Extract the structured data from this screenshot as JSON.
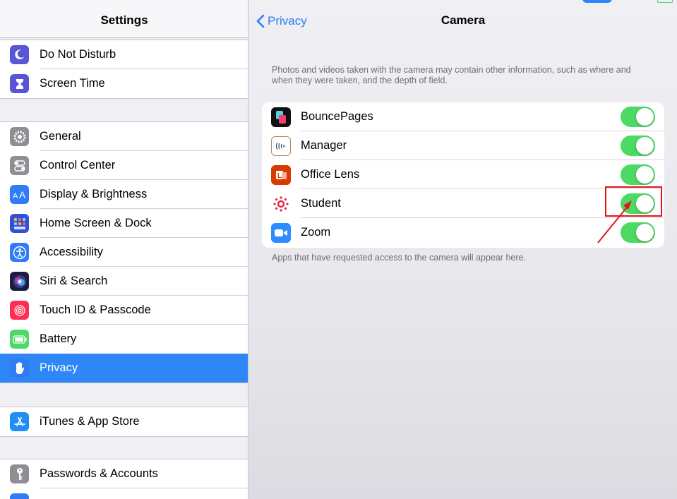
{
  "sidebar": {
    "title": "Settings",
    "items": [
      {
        "label": "Do Not Disturb",
        "icon": "moon-icon",
        "color": "#5856d6"
      },
      {
        "label": "Screen Time",
        "icon": "hourglass-icon",
        "color": "#5856d6"
      },
      {
        "label": "General",
        "icon": "gear-icon",
        "color": "#8e8e93"
      },
      {
        "label": "Control Center",
        "icon": "switches-icon",
        "color": "#8e8e93"
      },
      {
        "label": "Display & Brightness",
        "icon": "text-size-icon",
        "color": "#2f7cf6"
      },
      {
        "label": "Home Screen & Dock",
        "icon": "app-grid-icon",
        "color": "#2f52d8"
      },
      {
        "label": "Accessibility",
        "icon": "accessibility-icon",
        "color": "#2f7cf6"
      },
      {
        "label": "Siri & Search",
        "icon": "siri-icon",
        "color": "#1c1c3c"
      },
      {
        "label": "Touch ID & Passcode",
        "icon": "fingerprint-icon",
        "color": "#ff2d55"
      },
      {
        "label": "Battery",
        "icon": "battery-icon",
        "color": "#4cd964"
      },
      {
        "label": "Privacy",
        "icon": "hand-icon",
        "color": "#2f7cf6",
        "selected": true
      },
      {
        "label": "iTunes & App Store",
        "icon": "app-store-icon",
        "color": "#1f8ef5"
      },
      {
        "label": "Passwords & Accounts",
        "icon": "key-icon",
        "color": "#8e8e93"
      }
    ]
  },
  "detail": {
    "back_label": "Privacy",
    "title": "Camera",
    "note_top": "Photos and videos taken with the camera may contain other information, such as where and when they were taken, and the depth of field.",
    "apps": [
      {
        "label": "BouncePages",
        "icon": "bouncepages-icon",
        "enabled": true
      },
      {
        "label": "Manager",
        "icon": "manager-icon",
        "enabled": true
      },
      {
        "label": "Office Lens",
        "icon": "office-lens-icon",
        "enabled": true
      },
      {
        "label": "Student",
        "icon": "canvas-student-icon",
        "enabled": true
      },
      {
        "label": "Zoom",
        "icon": "zoom-icon",
        "enabled": true
      }
    ],
    "note_bottom": "Apps that have requested access to the camera will appear here."
  },
  "colors": {
    "accent": "#2f7cf6",
    "toggle_on": "#4cd964",
    "annotation": "#e0161c"
  }
}
